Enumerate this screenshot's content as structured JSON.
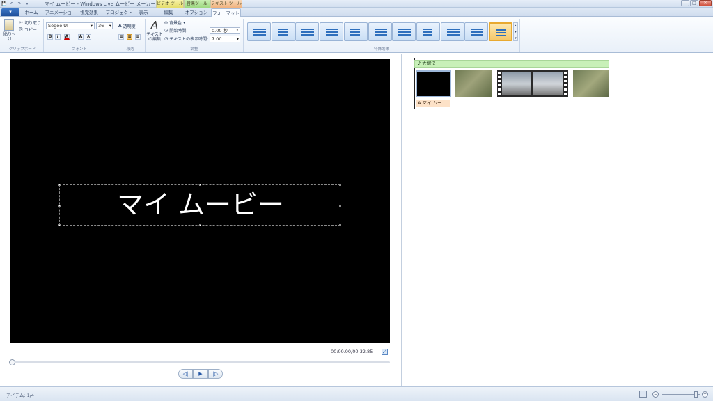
{
  "window": {
    "title": "マイ ムービー - Windows Live ムービー メーカー",
    "quick_access": [
      "💾",
      "↶",
      "↷",
      "▾"
    ],
    "controls": {
      "minimize": "–",
      "maximize": "□",
      "close": "✕"
    }
  },
  "contextual_tabs": {
    "video": "ビデオ ツール",
    "audio": "音楽ツール",
    "text": "テキスト ツール"
  },
  "tabs": [
    "ホーム",
    "アニメーション",
    "視覚効果",
    "プロジェクト",
    "表示",
    "編集",
    "オプション",
    "フォーマット"
  ],
  "active_tab": "フォーマット",
  "app_menu_label": "▾",
  "ribbon": {
    "clipboard": {
      "group": "クリップボード",
      "paste": "貼り付け",
      "cut": "切り取り",
      "copy": "コピー"
    },
    "font": {
      "group": "フォント",
      "family": "Segoe UI",
      "size": "36",
      "bold": "B",
      "italic": "I",
      "color": "A",
      "grow": "A",
      "shrink": "A"
    },
    "paragraph": {
      "group": "段落",
      "transparency": "透明度"
    },
    "adjust": {
      "group": "調整",
      "edit_text": "テキストの編集",
      "bg_color": "背景色",
      "start_time_label": "開始時間:",
      "start_time_value": "0.00 秒",
      "duration_label": "テキストの表示時間:",
      "duration_value": "7.00"
    },
    "effects": {
      "group": "特殊効果",
      "count": 11,
      "selected_index": 10
    }
  },
  "preview": {
    "caption": "マイ ムービー",
    "time": "00:00.00/00:32.85",
    "playback": {
      "prev": "◁|",
      "play": "▶",
      "next": "|▷"
    }
  },
  "storyboard": {
    "audio_label": "♪ 大解決",
    "title_clip_label": "A マイ ムー…"
  },
  "status": {
    "items": "アイテム: 1/4",
    "zoom_out": "−",
    "zoom_in": "+"
  }
}
